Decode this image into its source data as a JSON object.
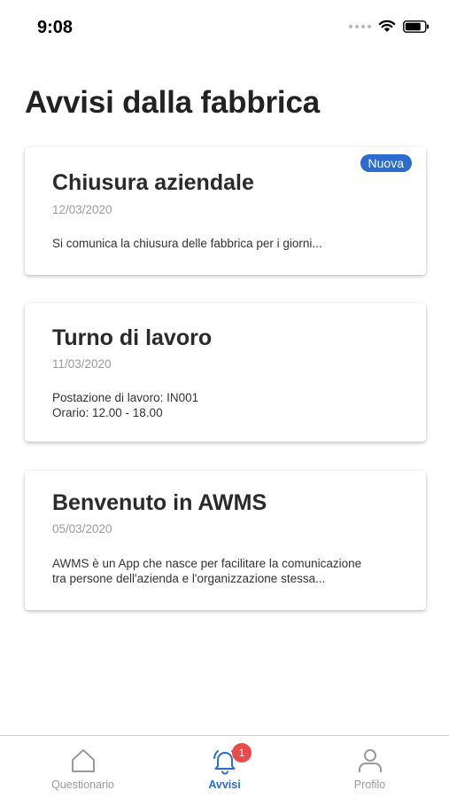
{
  "status_bar": {
    "time": "9:08"
  },
  "page": {
    "title": "Avvisi dalla fabbrica"
  },
  "cards": [
    {
      "title": "Chiusura aziendale",
      "date": "12/03/2020",
      "body": "Si comunica la chiusura delle fabbrica per i giorni...",
      "badge": "Nuova"
    },
    {
      "title": "Turno di lavoro",
      "date": "11/03/2020",
      "body": "Postazione di lavoro: IN001\nOrario: 12.00 - 18.00"
    },
    {
      "title": "Benvenuto in AWMS",
      "date": "05/03/2020",
      "body": "AWMS è un App che nasce per facilitare la comunicazione\ntra persone dell'azienda e l'organizzazione stessa..."
    }
  ],
  "tabs": [
    {
      "label": "Questionario",
      "icon": "home-icon"
    },
    {
      "label": "Avvisi",
      "icon": "bell-icon",
      "badge": "1",
      "active": true
    },
    {
      "label": "Profilo",
      "icon": "person-icon"
    }
  ],
  "colors": {
    "accent": "#2b6cce",
    "notification": "#e94b4b",
    "inactive": "#9a9a9a"
  }
}
